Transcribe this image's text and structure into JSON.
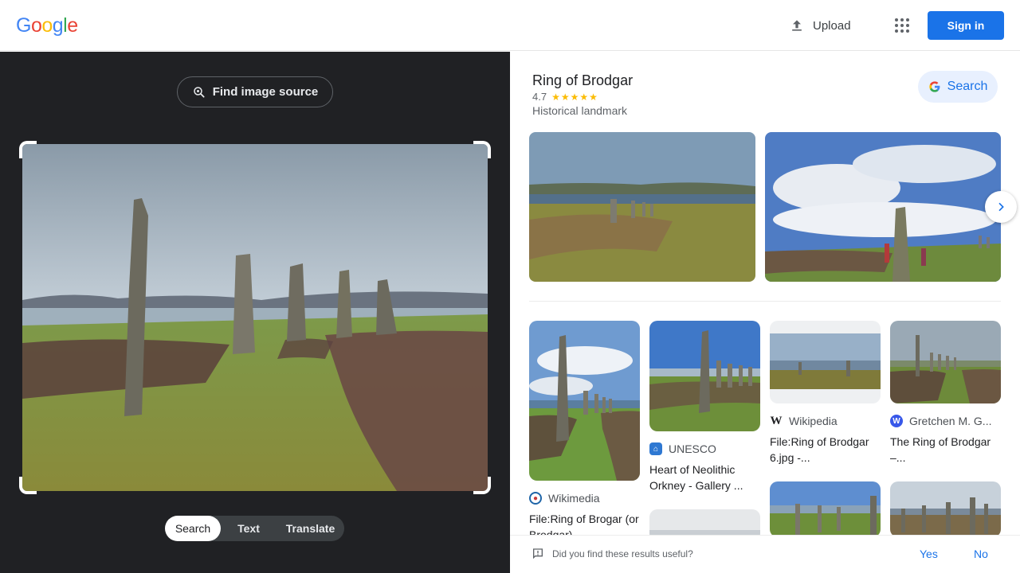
{
  "header": {
    "logo_letters": [
      "G",
      "o",
      "o",
      "g",
      "l",
      "e"
    ],
    "logo_colors": [
      "#4285f4",
      "#ea4335",
      "#fbbc05",
      "#4285f4",
      "#34a853",
      "#ea4335"
    ],
    "upload_label": "Upload",
    "signin_label": "Sign in"
  },
  "left_panel": {
    "find_source_label": "Find image source",
    "tabs": [
      {
        "label": "Search",
        "active": true
      },
      {
        "label": "Text",
        "active": false
      },
      {
        "label": "Translate",
        "active": false
      }
    ]
  },
  "knowledge_panel": {
    "title": "Ring of Brodgar",
    "rating": "4.7",
    "stars": "★★★★★",
    "rating_value": 4.7,
    "type": "Historical landmark",
    "search_label": "Search"
  },
  "results": [
    {
      "source": "Wikimedia",
      "title": "File:Ring of Brogar (or Brodgar)..."
    },
    {
      "source": "UNESCO",
      "title": "Heart of Neolithic Orkney - Gallery ..."
    },
    {
      "source": "Wikipedia",
      "title": "File:Ring of Brodgar 6.jpg -..."
    },
    {
      "source": "Gretchen M. G...",
      "title": "The Ring of Brodgar –..."
    }
  ],
  "feedback": {
    "question": "Did you find these results useful?",
    "yes_label": "Yes",
    "no_label": "No"
  },
  "colors": {
    "accent": "#1a73e8",
    "dark_panel": "#202124",
    "star": "#fbbc04"
  },
  "icons": [
    "upload-icon",
    "apps-grid-icon",
    "lens-search-icon",
    "google-g-icon",
    "chevron-right-icon",
    "feedback-icon",
    "wikimedia-icon",
    "unesco-icon",
    "wikipedia-icon",
    "wordpress-icon"
  ]
}
